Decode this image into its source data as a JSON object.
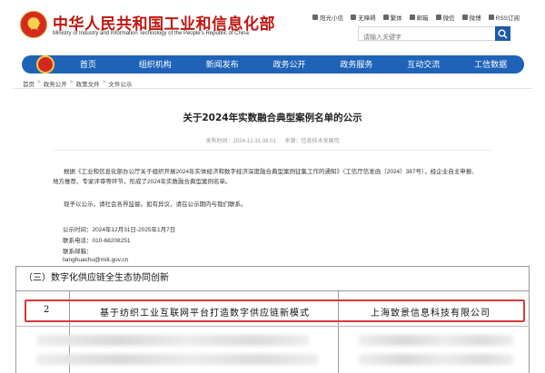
{
  "site": {
    "title": "中华人民共和国工业和信息化部",
    "subtitle": "Ministry of Industry and Information Technology of the People's Republic of China"
  },
  "toplinks": [
    {
      "label": "阳光小信",
      "icon": "sun-icon"
    },
    {
      "label": "无障碍",
      "icon": "accessibility-icon"
    },
    {
      "label": "繁体",
      "icon": "traditional-icon"
    },
    {
      "label": "邮箱",
      "icon": "mail-icon"
    },
    {
      "label": "微信",
      "icon": "wechat-icon"
    },
    {
      "label": "微博",
      "icon": "weibo-icon"
    },
    {
      "label": "RSS订阅",
      "icon": "rss-icon"
    }
  ],
  "search": {
    "placeholder": "请输入关键字"
  },
  "nav": {
    "items": [
      "首页",
      "组织机构",
      "新闻发布",
      "政务公开",
      "政务服务",
      "互动交流",
      "工信数据"
    ],
    "color": "#1e63b8"
  },
  "breadcrumb": [
    "首页",
    "政务公开",
    "政策文件",
    "文件公示"
  ],
  "article": {
    "title": "关于2024年实数融合典型案例名单的公示",
    "date": "发布时间：2024-12-31 08:01",
    "source": "来源：信息技术发展司",
    "p1": "根据《工业和信息化部办公厅关于组织开展2024年实体经济和数字经济深度融合典型案例征集工作的通知》（工信厅信发函〔2024〕387号），经企业自主申报、地方推荐、专家评审等环节，形成了2024年实数融合典型案例名单。",
    "p2": "现予以公示，请社会各界监督。如有异议，请在公示期内与我们联系。",
    "period": "公示时间：2024年12月31日-2025年1月7日",
    "phone_label": "联系电话：",
    "phone": "010-68208251",
    "email_label": "联系邮箱：",
    "email": "lianghuachu@miit.gov.cn"
  },
  "table": {
    "section": "（三）数字化供应链全生态协同创新",
    "row": {
      "no": "2",
      "name": "基于纺织工业互联网平台打造数字供应链新模式",
      "company": "上海致景信息科技有限公司"
    },
    "highlight_color": "#d63a3a"
  }
}
